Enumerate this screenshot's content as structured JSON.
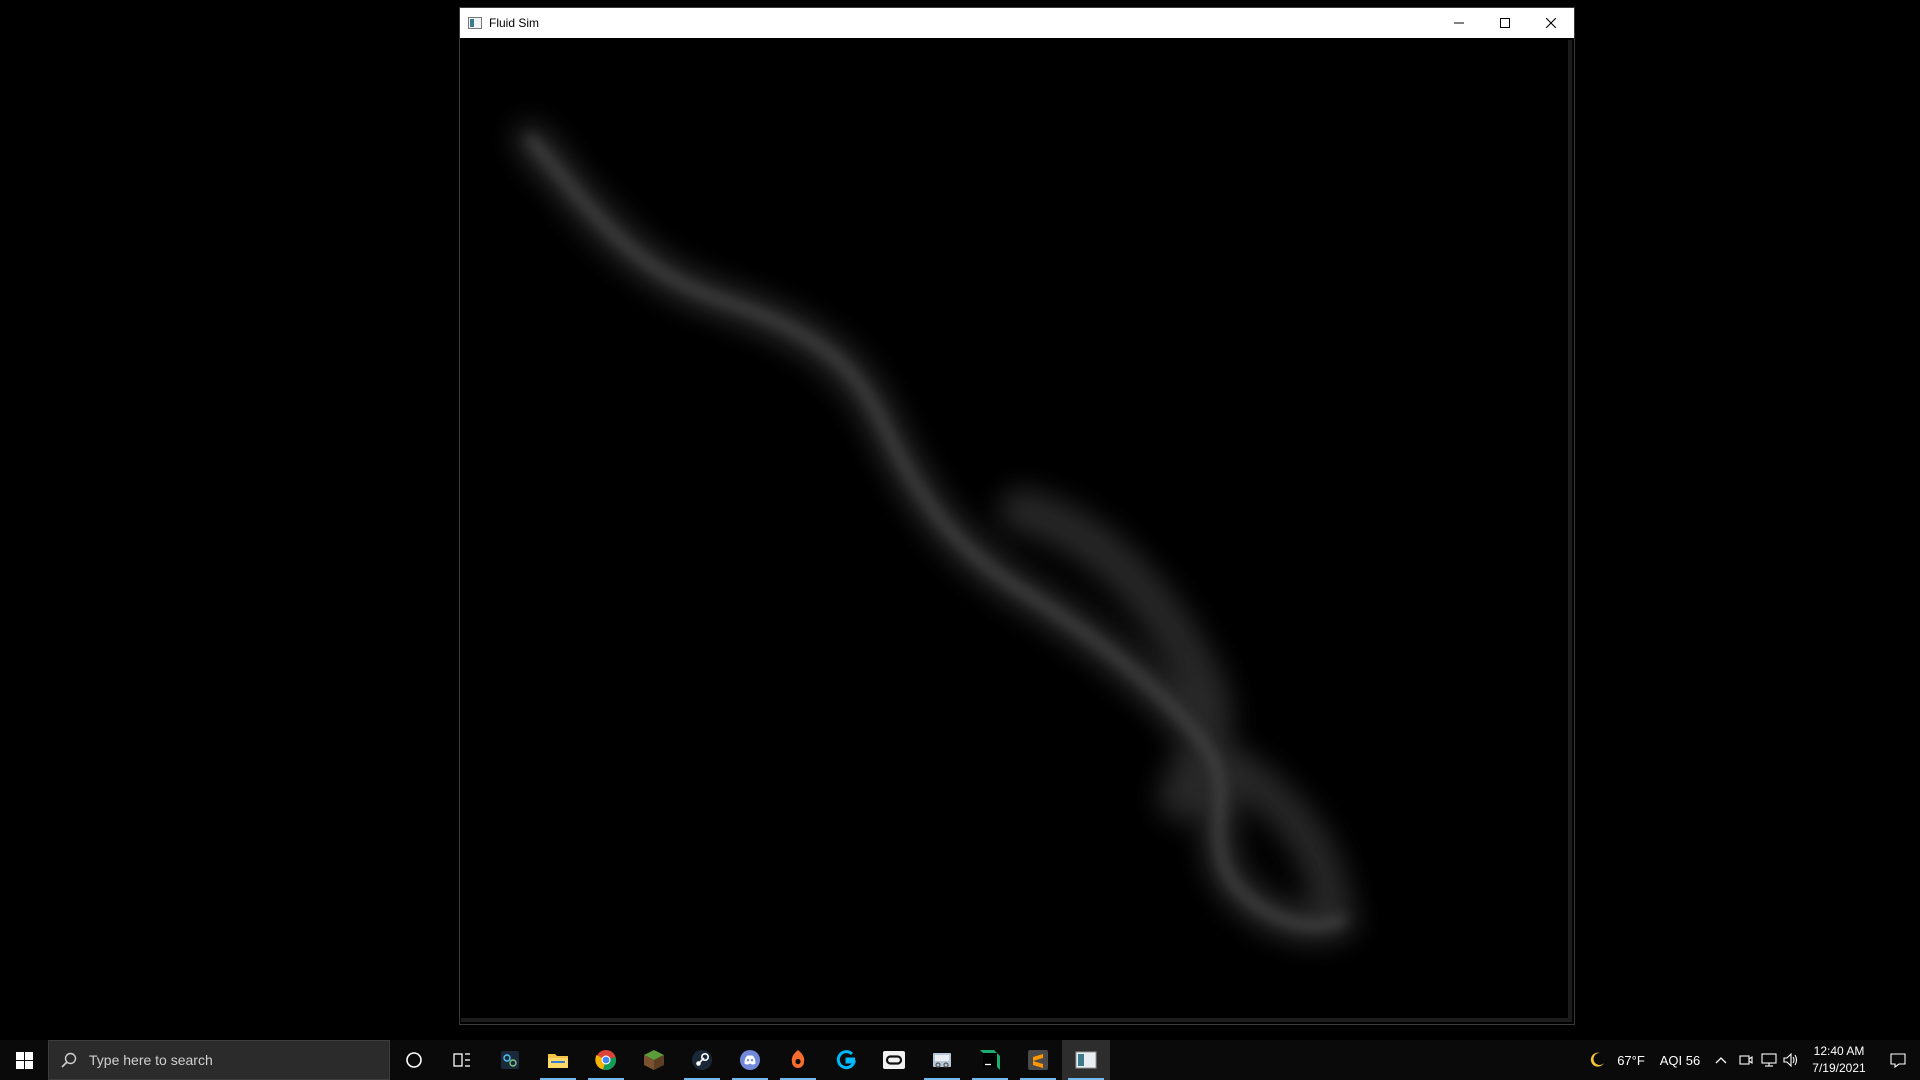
{
  "window": {
    "title": "Fluid Sim",
    "minimize_icon": "minimize-icon",
    "maximize_icon": "maximize-icon",
    "close_icon": "close-icon"
  },
  "canvas": {
    "background": "#000000",
    "smoke_color": "#5a5a5a"
  },
  "taskbar": {
    "search_placeholder": "Type here to search",
    "pinned_apps": [
      {
        "name": "cortana-icon",
        "running": false
      },
      {
        "name": "task-view-icon",
        "running": false
      },
      {
        "name": "settings-app-icon",
        "running": false
      },
      {
        "name": "file-explorer-icon",
        "running": true
      },
      {
        "name": "chrome-icon",
        "running": true
      },
      {
        "name": "minecraft-icon",
        "running": false
      },
      {
        "name": "steam-icon",
        "running": true
      },
      {
        "name": "discord-icon",
        "running": true
      },
      {
        "name": "origin-icon",
        "running": true
      },
      {
        "name": "logitech-g-icon",
        "running": false
      },
      {
        "name": "oculus-icon",
        "running": false
      },
      {
        "name": "snipping-tool-icon",
        "running": true
      },
      {
        "name": "webstorm-icon",
        "running": true
      },
      {
        "name": "sublime-text-icon",
        "running": true
      },
      {
        "name": "fluid-sim-app-icon",
        "running": true,
        "active": true
      }
    ],
    "weather": {
      "icon": "moon-icon",
      "temperature": "67°F",
      "aqi": "AQI 56"
    },
    "clock": {
      "time": "12:40 AM",
      "date": "7/19/2021"
    }
  }
}
